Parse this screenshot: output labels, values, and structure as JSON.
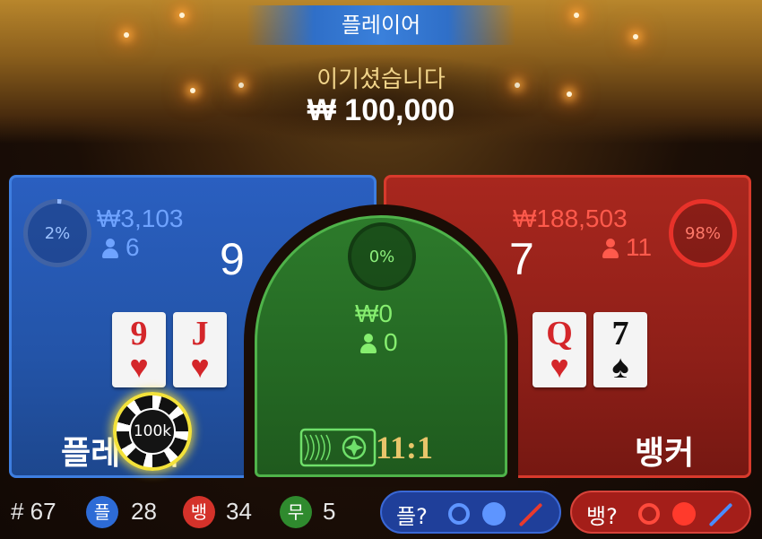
{
  "header": {
    "winner_label": "플레이어",
    "win_message": "이기셨습니다",
    "win_amount": "₩ 100,000"
  },
  "player": {
    "percent": "2%",
    "percent_value": 0.02,
    "bet_total": "₩3,103",
    "bettors": "6",
    "score": "9",
    "label": "플레이어",
    "cards": [
      {
        "rank": "9",
        "suit": "♥"
      },
      {
        "rank": "J",
        "suit": "♥"
      }
    ],
    "chip_value": "100k"
  },
  "tie": {
    "percent": "0%",
    "bet_total": "₩0",
    "bettors": "0",
    "payout": "11:1"
  },
  "banker": {
    "percent": "98%",
    "percent_value": 0.98,
    "bet_total": "₩188,503",
    "bettors": "11",
    "score": "7",
    "label": "뱅커",
    "cards": [
      {
        "rank": "Q",
        "suit": "♥"
      },
      {
        "rank": "7",
        "suit": "♠"
      }
    ]
  },
  "stats": {
    "round_label": "# 67",
    "player_badge": "플",
    "player_wins": "28",
    "banker_badge": "뱅",
    "banker_wins": "34",
    "tie_badge": "무",
    "tie_wins": "5"
  },
  "predict": {
    "player_label": "플?",
    "banker_label": "뱅?"
  },
  "colors": {
    "player": "#2a5fc0",
    "banker": "#a8271e",
    "tie": "#2d7a2b",
    "chip_glow": "#f3e23a",
    "odds": "#e8c56a"
  }
}
